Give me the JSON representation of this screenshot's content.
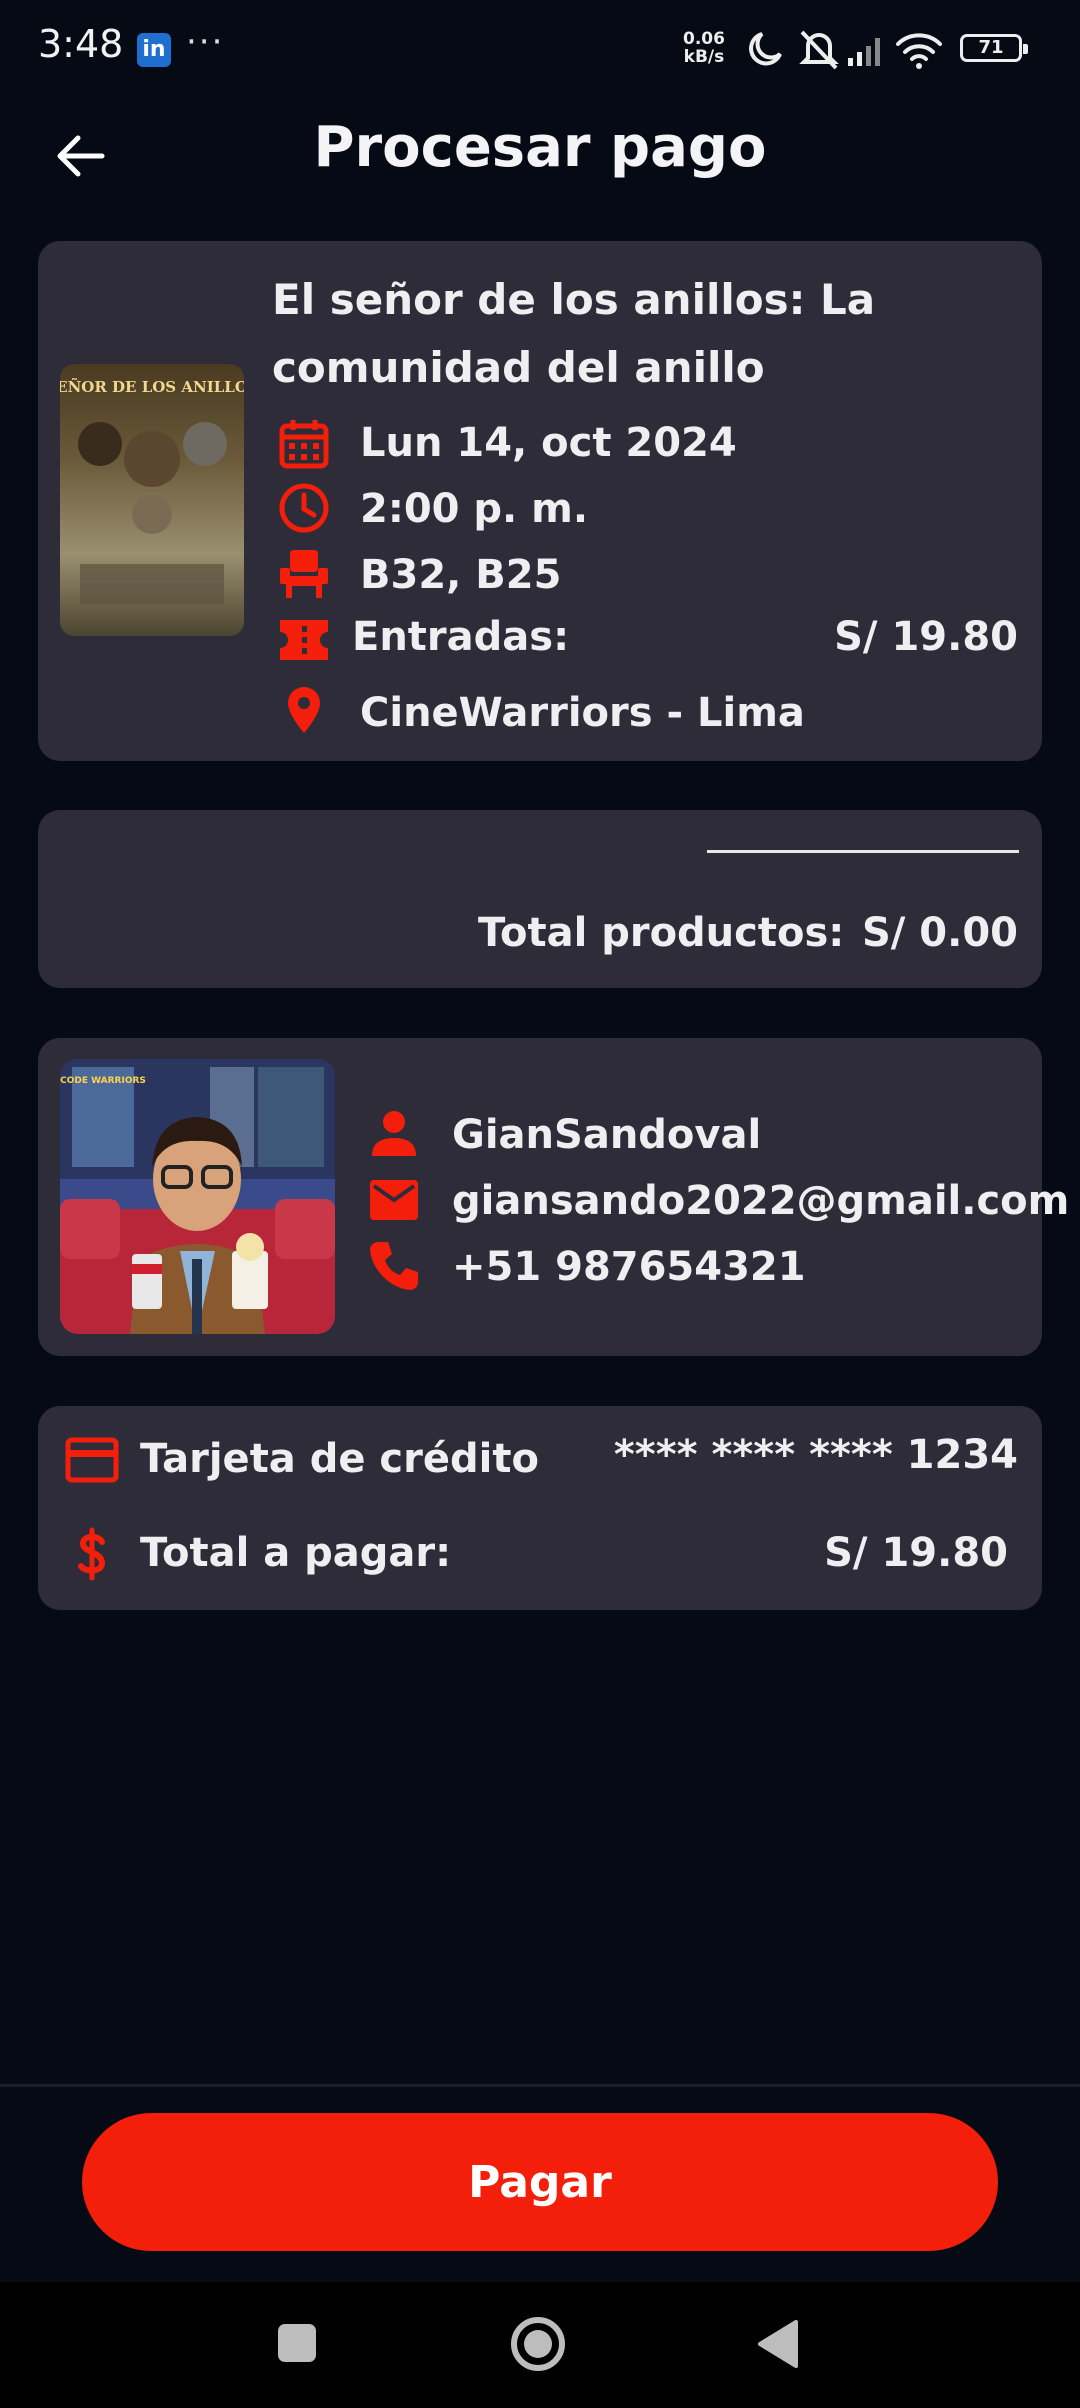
{
  "status_bar": {
    "time": "3:48",
    "app_badge": "in",
    "more": "···",
    "net_speed_value": "0.06",
    "net_speed_unit": "kB/s",
    "battery": "71"
  },
  "header": {
    "title": "Procesar pago"
  },
  "movie": {
    "title": "El señor de los anillos: La comunidad del anillo",
    "date": "Lun 14, oct 2024",
    "time": "2:00 p. m.",
    "seats": "B32, B25",
    "tickets_label": "Entradas:",
    "tickets_price": "S/ 19.80",
    "cinema": "CineWarriors - Lima",
    "poster_caption_top": "SEÑOR DE LOS ANILLOS"
  },
  "products": {
    "total_label": "Total productos:",
    "total_value": "S/ 0.00"
  },
  "user": {
    "name": "GianSandoval",
    "email": "giansando2022@gmail.com",
    "phone": "+51 987654321",
    "poster_text": "CODE WARRIORS"
  },
  "payment": {
    "method_label": "Tarjeta de crédito",
    "card_masked": "**** **** **** 1234",
    "total_label": "Total a pagar:",
    "total_value": "S/ 19.80"
  },
  "action": {
    "pay_label": "Pagar"
  },
  "colors": {
    "accent": "#f31f0b",
    "card_bg": "#2d2c38",
    "page_bg": "#060a14"
  },
  "icons": [
    "back-arrow-icon",
    "calendar-icon",
    "clock-icon",
    "seat-icon",
    "ticket-icon",
    "location-pin-icon",
    "person-icon",
    "mail-icon",
    "phone-icon",
    "credit-card-icon",
    "dollar-icon",
    "recent-apps-icon",
    "home-icon",
    "back-nav-icon"
  ]
}
